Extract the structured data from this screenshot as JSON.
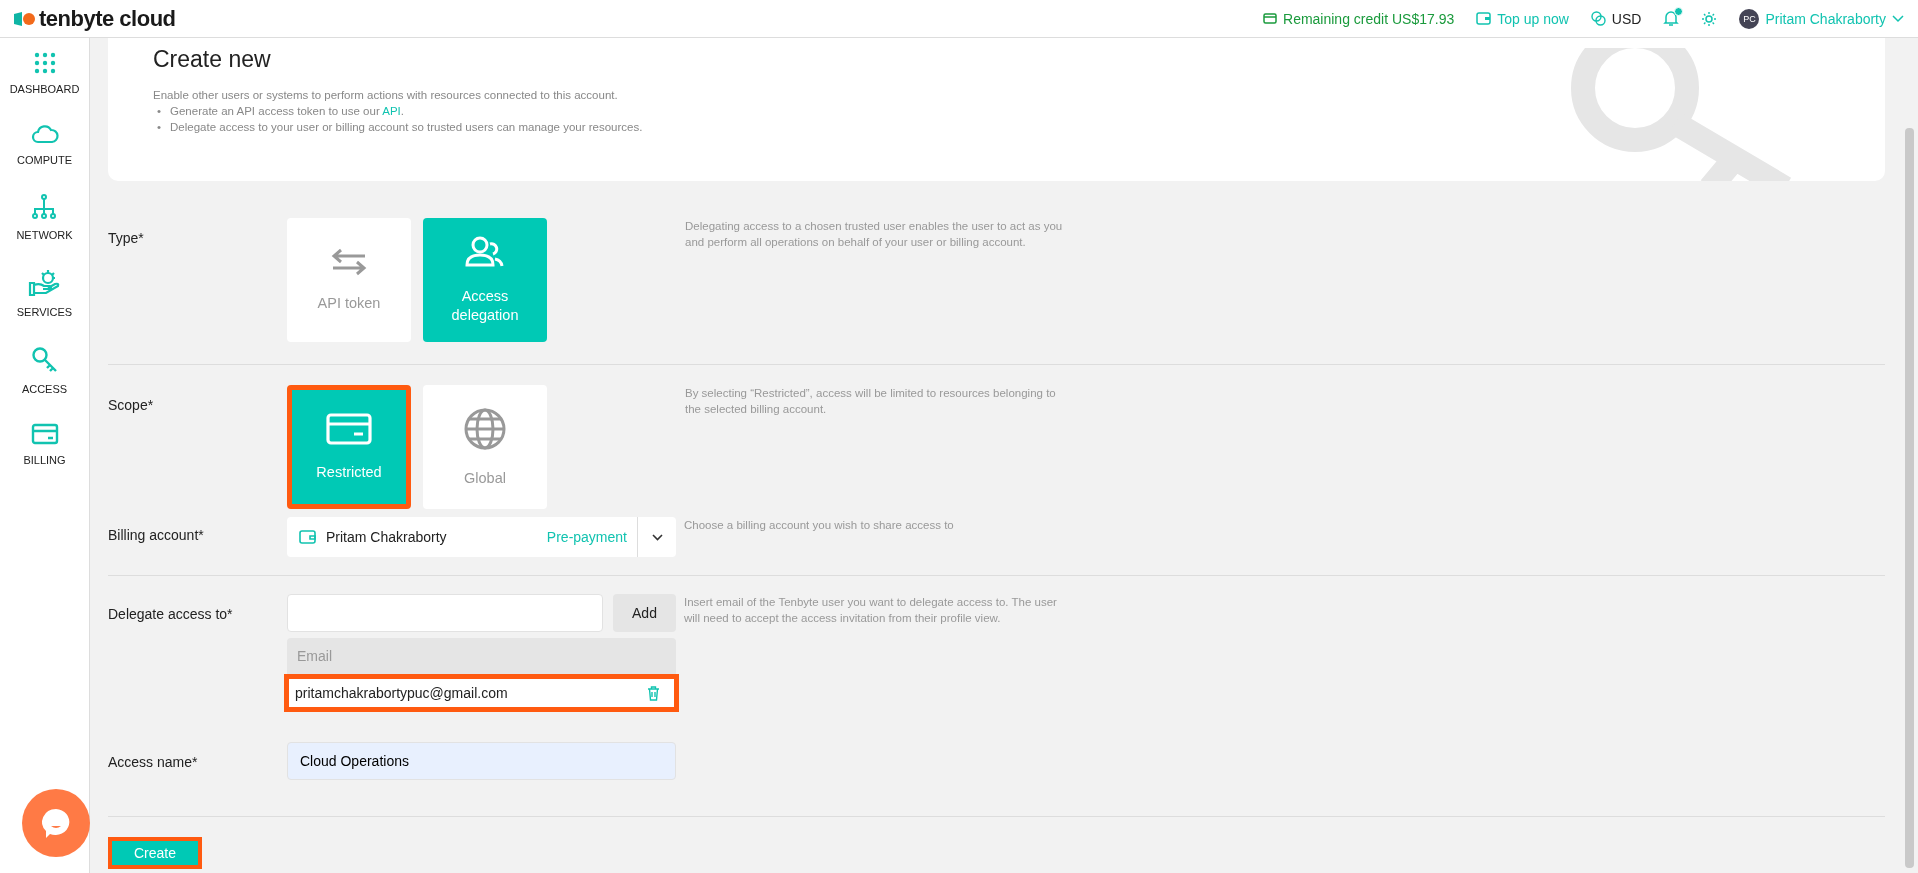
{
  "header": {
    "brand": "tenbyte cloud",
    "credit": "Remaining credit US$17.93",
    "top_up": "Top up now",
    "currency": "USD",
    "notification_unread": true,
    "user": "Pritam Chakraborty",
    "user_initials": "PC"
  },
  "sidebar": {
    "items": [
      {
        "label": "DASHBOARD",
        "kind": "dashboard"
      },
      {
        "label": "COMPUTE",
        "kind": "compute"
      },
      {
        "label": "NETWORK",
        "kind": "network"
      },
      {
        "label": "SERVICES",
        "kind": "services"
      },
      {
        "label": "ACCESS",
        "kind": "access"
      },
      {
        "label": "BILLING",
        "kind": "billing"
      }
    ]
  },
  "intro": {
    "title": "Create new",
    "text": "Enable other users or systems to perform actions with resources connected to this account.",
    "bullets": [
      {
        "marker": "•",
        "before": "Generate an API access token to use our ",
        "link": "API",
        "after": "."
      },
      {
        "marker": "•",
        "before": "Delegate access to your user or billing account so trusted users can manage your resources."
      }
    ]
  },
  "type": {
    "label": "Type*",
    "options": [
      {
        "label": "API token",
        "kind": "arrows",
        "selected": false,
        "highlighted": false
      },
      {
        "label": "Access delegation",
        "kind": "users",
        "selected": true,
        "highlighted": false
      }
    ],
    "help": "Delegating access to a chosen trusted user enables the user to act as you and perform all operations on behalf of your user or billing account."
  },
  "scope": {
    "label": "Scope*",
    "options": [
      {
        "label": "Restricted",
        "kind": "card",
        "selected": true,
        "highlighted": true
      },
      {
        "label": "Global",
        "kind": "globe",
        "selected": false,
        "highlighted": false
      }
    ],
    "help": "By selecting “Restricted”, access will be limited to resources belonging to the selected billing account."
  },
  "billing_account": {
    "label": "Billing account*",
    "value": "Pritam Chakraborty",
    "plan": "Pre-payment",
    "help": "Choose a billing account you wish to share access to"
  },
  "delegate": {
    "label": "Delegate access to*",
    "add": "Add",
    "help": "Insert email of the Tenbyte user you want to delegate access to. The user will need to accept the access invitation from their profile view.",
    "column": "Email",
    "emails": [
      {
        "email": "pritamchakrabortypuc@gmail.com",
        "highlighted": true
      }
    ]
  },
  "access_name": {
    "label": "Access name*",
    "value": "Cloud Operations"
  },
  "create": {
    "label": "Create",
    "highlighted": true
  }
}
